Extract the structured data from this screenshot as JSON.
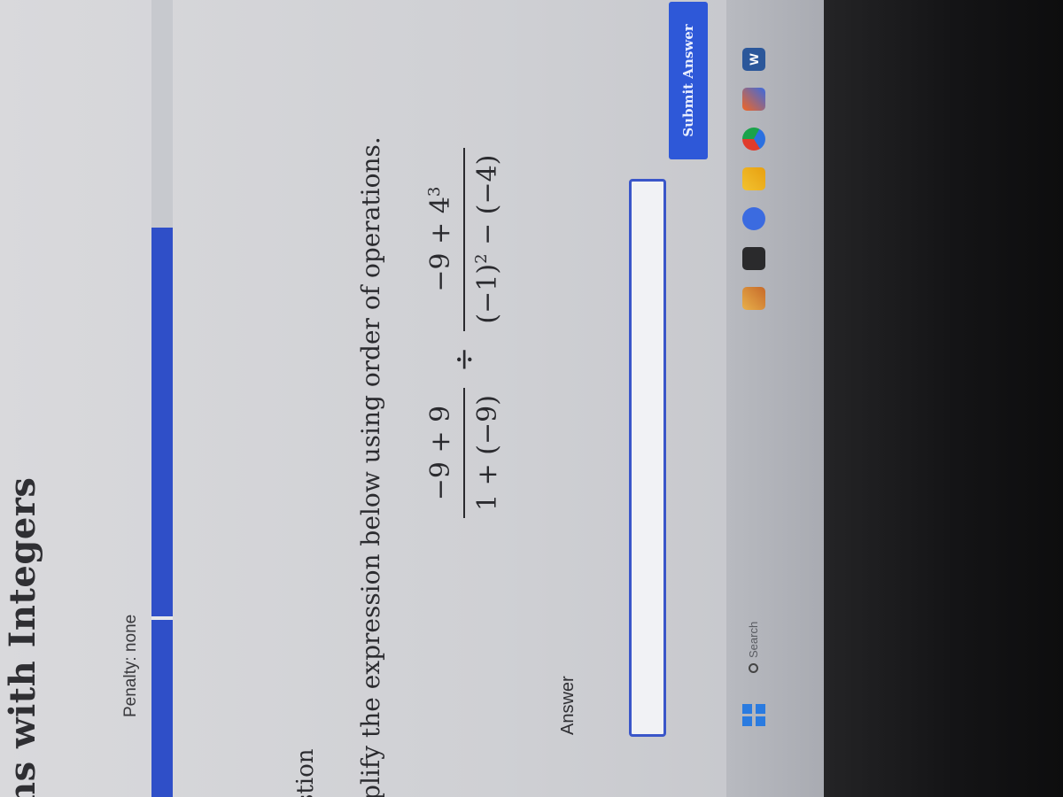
{
  "header": {
    "title": "ns with Integers",
    "penalty": "Penalty: none"
  },
  "progress": {
    "filled_fraction": 0.71,
    "color": "#2f4fc8"
  },
  "question": {
    "section_label": "stion",
    "instruction": "nplify the expression below using order of operations.",
    "fraction1": {
      "numerator": "−9 + 9",
      "denominator": "1 + (−9)"
    },
    "operator": "÷",
    "fraction2": {
      "numerator_base": "−9 + 4",
      "numerator_exp": "3",
      "denominator_base": "(−1)",
      "denominator_exp": "2",
      "denominator_tail": " − (−4)"
    }
  },
  "answer": {
    "label": "Answer",
    "input_value": "",
    "submit_label": "Submit Answer"
  },
  "taskbar": {
    "search_label": "Search",
    "icons": [
      "windows-start-icon",
      "search-icon",
      "widgets-icon",
      "task-view-icon",
      "teams-icon",
      "file-explorer-icon",
      "chrome-icon",
      "office-icon",
      "word-icon"
    ],
    "word_letter": "W"
  }
}
